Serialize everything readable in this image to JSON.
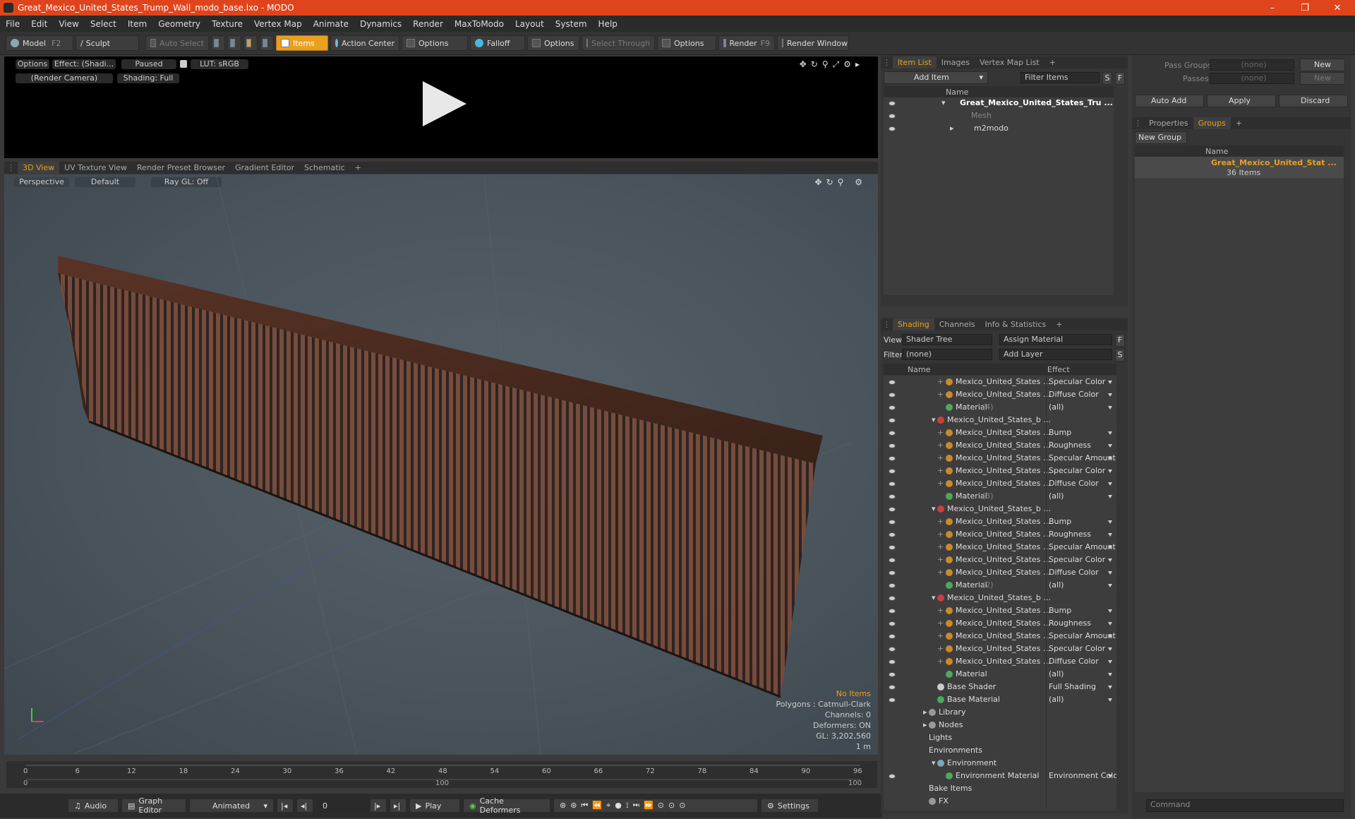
{
  "window": {
    "title": "Great_Mexico_United_States_Trump_Wall_modo_base.lxo - MODO",
    "controls": [
      "–",
      "❐",
      "✕"
    ]
  },
  "menu": [
    "File",
    "Edit",
    "View",
    "Select",
    "Item",
    "Geometry",
    "Texture",
    "Vertex Map",
    "Animate",
    "Dynamics",
    "Render",
    "MaxToModo",
    "Layout",
    "System",
    "Help"
  ],
  "toolbar": {
    "model": "Model",
    "model_key": "F2",
    "sculpt": "Sculpt",
    "auto_select": "Auto Select",
    "items": "Items",
    "action_center": "Action Center",
    "options1": "Options",
    "falloff": "Falloff",
    "options2": "Options",
    "select_through": "Select Through",
    "options3": "Options",
    "render": "Render",
    "render_key": "F9",
    "render_window": "Render Window"
  },
  "preview": {
    "options": "Options",
    "effect": "Effect: (Shadi...",
    "paused": "Paused",
    "lut": "LUT: sRGB",
    "camera": "(Render Camera)",
    "shading": "Shading: Full"
  },
  "view_tabs": [
    "3D View",
    "UV Texture View",
    "Render Preset Browser",
    "Gradient Editor",
    "Schematic",
    "+"
  ],
  "viewport": {
    "perspective": "Perspective",
    "default": "Default",
    "raygl": "Ray GL: Off",
    "info": {
      "items": "No Items",
      "polygons": "Polygons : Catmull-Clark",
      "channels": "Channels: 0",
      "deformers": "Deformers: ON",
      "gl": "GL: 3,202,560",
      "scale": "1 m"
    }
  },
  "timeline": {
    "ticks": [
      "0",
      "6",
      "12",
      "18",
      "24",
      "30",
      "36",
      "42",
      "48",
      "54",
      "60",
      "66",
      "72",
      "78",
      "84",
      "90",
      "96"
    ],
    "sub_start": "0",
    "sub_mid": "100",
    "sub_end": "100"
  },
  "bottom": {
    "audio": "Audio",
    "graph_editor": "Graph Editor",
    "animated": "Animated",
    "frame": "0",
    "play": "Play",
    "cache": "Cache Deformers",
    "settings": "Settings"
  },
  "item_list": {
    "tabs": [
      "Item List",
      "Images",
      "Vertex Map List",
      "+"
    ],
    "add_item": "Add Item",
    "filter_items": "Filter Items",
    "s": "S",
    "f": "F",
    "col_name": "Name",
    "items": [
      "Great_Mexico_United_States_Tru ...",
      "Mesh",
      "m2modo"
    ]
  },
  "shading": {
    "tabs": [
      "Shading",
      "Channels",
      "Info & Statistics",
      "+"
    ],
    "view_label": "View",
    "view_value": "Shader Tree",
    "assign": "Assign Material",
    "f": "F",
    "filter_label": "Filter",
    "filter_value": "(none)",
    "add_layer": "Add Layer",
    "s": "S",
    "col_name": "Name",
    "col_effect": "Effect",
    "rows": [
      {
        "name": "Mexico_United_States ...",
        "effect": "Specular Color",
        "indent": 3,
        "kind": "tex"
      },
      {
        "name": "Mexico_United_States ...",
        "effect": "Diffuse Color",
        "indent": 3,
        "kind": "tex"
      },
      {
        "name": "Material",
        "suffix": "(4)",
        "effect": "(all)",
        "indent": 3,
        "kind": "mat"
      },
      {
        "name": "Mexico_United_States_b ...",
        "effect": "",
        "indent": 2,
        "kind": "grp"
      },
      {
        "name": "Mexico_United_States ...",
        "effect": "Bump",
        "indent": 3,
        "kind": "tex"
      },
      {
        "name": "Mexico_United_States ...",
        "effect": "Roughness",
        "indent": 3,
        "kind": "tex"
      },
      {
        "name": "Mexico_United_States ...",
        "effect": "Specular Amount",
        "indent": 3,
        "kind": "tex"
      },
      {
        "name": "Mexico_United_States ...",
        "effect": "Specular Color",
        "indent": 3,
        "kind": "tex"
      },
      {
        "name": "Mexico_United_States ...",
        "effect": "Diffuse Color",
        "indent": 3,
        "kind": "tex"
      },
      {
        "name": "Material",
        "suffix": "(3)",
        "effect": "(all)",
        "indent": 3,
        "kind": "mat"
      },
      {
        "name": "Mexico_United_States_b ...",
        "effect": "",
        "indent": 2,
        "kind": "grp"
      },
      {
        "name": "Mexico_United_States ...",
        "effect": "Bump",
        "indent": 3,
        "kind": "tex"
      },
      {
        "name": "Mexico_United_States ...",
        "effect": "Roughness",
        "indent": 3,
        "kind": "tex"
      },
      {
        "name": "Mexico_United_States ...",
        "effect": "Specular Amount",
        "indent": 3,
        "kind": "tex"
      },
      {
        "name": "Mexico_United_States ...",
        "effect": "Specular Color",
        "indent": 3,
        "kind": "tex"
      },
      {
        "name": "Mexico_United_States ...",
        "effect": "Diffuse Color",
        "indent": 3,
        "kind": "tex"
      },
      {
        "name": "Material",
        "suffix": "(2)",
        "effect": "(all)",
        "indent": 3,
        "kind": "mat"
      },
      {
        "name": "Mexico_United_States_b ...",
        "effect": "",
        "indent": 2,
        "kind": "grp"
      },
      {
        "name": "Mexico_United_States ...",
        "effect": "Bump",
        "indent": 3,
        "kind": "tex"
      },
      {
        "name": "Mexico_United_States ...",
        "effect": "Roughness",
        "indent": 3,
        "kind": "tex"
      },
      {
        "name": "Mexico_United_States ...",
        "effect": "Specular Amount",
        "indent": 3,
        "kind": "tex"
      },
      {
        "name": "Mexico_United_States ...",
        "effect": "Specular Color",
        "indent": 3,
        "kind": "tex"
      },
      {
        "name": "Mexico_United_States ...",
        "effect": "Diffuse Color",
        "indent": 3,
        "kind": "tex"
      },
      {
        "name": "Material",
        "effect": "(all)",
        "indent": 3,
        "kind": "mat"
      },
      {
        "name": "Base Shader",
        "effect": "Full Shading",
        "indent": 2,
        "kind": "shader"
      },
      {
        "name": "Base Material",
        "effect": "(all)",
        "indent": 2,
        "kind": "mat"
      },
      {
        "name": "Library",
        "effect": "",
        "indent": 1,
        "kind": "folder"
      },
      {
        "name": "Nodes",
        "effect": "",
        "indent": 1,
        "kind": "folder"
      },
      {
        "name": "Lights",
        "effect": "",
        "indent": 1,
        "kind": "plain"
      },
      {
        "name": "Environments",
        "effect": "",
        "indent": 1,
        "kind": "plain"
      },
      {
        "name": "Environment",
        "effect": "",
        "indent": 2,
        "kind": "env"
      },
      {
        "name": "Environment Material",
        "effect": "Environment Color",
        "indent": 3,
        "kind": "mat"
      },
      {
        "name": "Bake Items",
        "effect": "",
        "indent": 1,
        "kind": "plain"
      },
      {
        "name": "FX",
        "effect": "",
        "indent": 1,
        "kind": "fx"
      }
    ]
  },
  "groups": {
    "pass_groups": "Pass Groups",
    "passes": "Passes",
    "none1": "(none)",
    "none2": "(none)",
    "new1": "New",
    "new2": "New",
    "auto_add": "Auto Add",
    "apply": "Apply",
    "discard": "Discard",
    "tabs": [
      "Properties",
      "Groups",
      "+"
    ],
    "new_group": "New Group",
    "col_name": "Name",
    "group_name": "Great_Mexico_United_Stat ...",
    "group_count": "36 Items",
    "command": "Command"
  },
  "colors": {
    "accent": "#e8a020",
    "title": "#e0441c",
    "wall_rust": "#6a3a2a"
  }
}
